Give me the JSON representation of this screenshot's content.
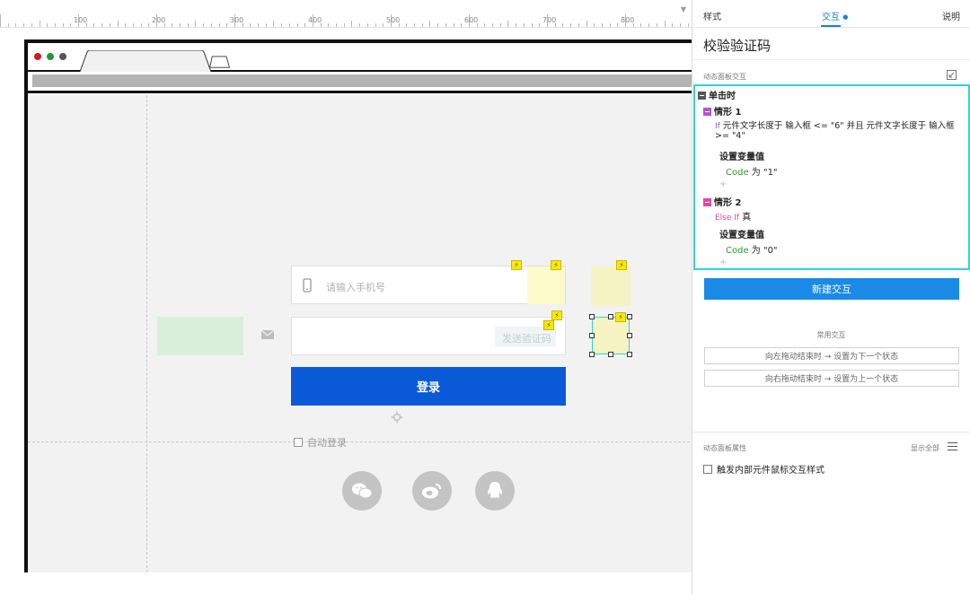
{
  "ruler": {
    "labels": [
      "100",
      "200",
      "300",
      "400",
      "500",
      "600",
      "700",
      "800"
    ]
  },
  "canvas": {
    "phone_placeholder": "请输入手机号",
    "send_code_label": "发送验证码",
    "login_label": "登录",
    "auto_login_label": "自动登录",
    "flag_glyph": "⚡",
    "social_icons": [
      "wechat-icon",
      "weibo-icon",
      "qq-icon"
    ],
    "colors": {
      "login_button": "#0a5ad8",
      "note": "#fbf9c4",
      "green_block": "#d9efd9",
      "selection": "#35d1d1"
    }
  },
  "panel": {
    "tabs": [
      "样式",
      "交互",
      "说明"
    ],
    "active_tab": "交互",
    "title": "校验验证码",
    "section_label": "动态面板交互",
    "event_name": "单击时",
    "case1": {
      "name": "情形 1",
      "keyword": "If",
      "condition_line1": "元件文字长度于 输入框 <= \"6\" 并且 元件文字长度于 输入框",
      "condition_line2": ">= \"4\"",
      "action": "设置变量值",
      "var": "Code",
      "assign": "为 \"1\""
    },
    "case2": {
      "name": "情形 2",
      "keyword": "Else If",
      "condition": "真",
      "action": "设置变量值",
      "var": "Code",
      "assign": "为 \"0\""
    },
    "plus": "+",
    "new_interaction_label": "新建交互",
    "common_label": "常用交互",
    "quick_actions": [
      "向左拖动结束时 → 设置为下一个状态",
      "向右拖动结束时 → 设置为上一个状态"
    ],
    "props_label": "动态面板属性",
    "show_all_label": "显示全部",
    "checkbox_label": "触发内部元件鼠标交互样式",
    "colors": {
      "accent": "#1a7fe0",
      "case_square": "#b055d8",
      "event_square": "#555555"
    }
  }
}
